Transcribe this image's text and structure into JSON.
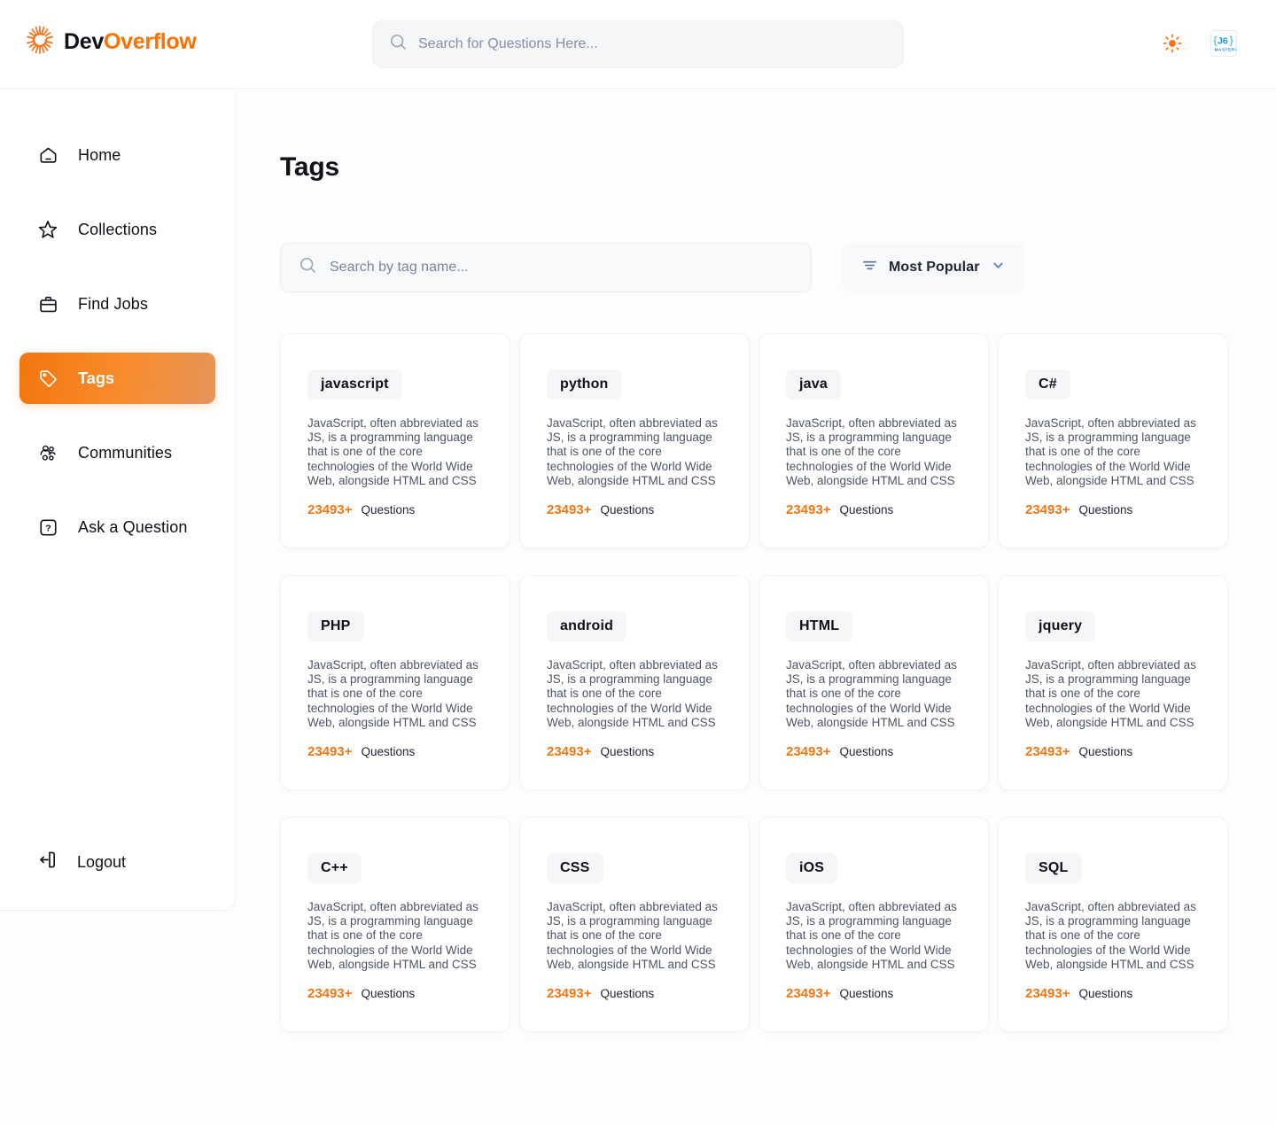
{
  "navbar": {
    "brand_prefix": "Dev",
    "brand_suffix": "Overflow",
    "logo_icon": "sun-burst-icon",
    "search": {
      "placeholder": "Search for Questions Here...",
      "value": "",
      "icon": "search-icon"
    },
    "theme_toggle_icon": "sun-icon",
    "avatar_label": "JS MASTERY",
    "accent_color": "#FF7000"
  },
  "sidebar": {
    "items": [
      {
        "label": "Home",
        "icon": "home-icon",
        "active": false
      },
      {
        "label": "Collections",
        "icon": "star-icon",
        "active": false
      },
      {
        "label": "Find Jobs",
        "icon": "suitcase-icon",
        "active": false
      },
      {
        "label": "Tags",
        "icon": "tag-icon",
        "active": true
      },
      {
        "label": "Communities",
        "icon": "users-icon",
        "active": false
      },
      {
        "label": "Ask a Question",
        "icon": "question-mark-icon",
        "active": false
      }
    ],
    "logout": {
      "label": "Logout",
      "icon": "logout-icon"
    },
    "active_gradient_from": "#F2760E",
    "active_gradient_to": "#E5955B"
  },
  "main": {
    "page_title": "Tags",
    "search": {
      "placeholder": "Search by tag name...",
      "value": "",
      "icon": "search-icon"
    },
    "sort": {
      "label": "Most Popular",
      "icon": "filter-lines-icon",
      "chevron": "chevron-down-icon"
    },
    "questions_word": "Questions",
    "tags": [
      {
        "name": "javascript",
        "description": "JavaScript, often abbreviated as JS, is a programming language that is one of the core technologies of the World Wide Web, alongside HTML and CSS",
        "count": "23493+"
      },
      {
        "name": "python",
        "description": "JavaScript, often abbreviated as JS, is a programming language that is one of the core technologies of the World Wide Web, alongside HTML and CSS",
        "count": "23493+"
      },
      {
        "name": "java",
        "description": "JavaScript, often abbreviated as JS, is a programming language that is one of the core technologies of the World Wide Web, alongside HTML and CSS",
        "count": "23493+"
      },
      {
        "name": "C#",
        "description": "JavaScript, often abbreviated as JS, is a programming language that is one of the core technologies of the World Wide Web, alongside HTML and CSS",
        "count": "23493+"
      },
      {
        "name": "PHP",
        "description": "JavaScript, often abbreviated as JS, is a programming language that is one of the core technologies of the World Wide Web, alongside HTML and CSS",
        "count": "23493+"
      },
      {
        "name": "android",
        "description": "JavaScript, often abbreviated as JS, is a programming language that is one of the core technologies of the World Wide Web, alongside HTML and CSS",
        "count": "23493+"
      },
      {
        "name": "HTML",
        "description": "JavaScript, often abbreviated as JS, is a programming language that is one of the core technologies of the World Wide Web, alongside HTML and CSS",
        "count": "23493+"
      },
      {
        "name": "jquery",
        "description": "JavaScript, often abbreviated as JS, is a programming language that is one of the core technologies of the World Wide Web, alongside HTML and CSS",
        "count": "23493+"
      },
      {
        "name": "C++",
        "description": "JavaScript, often abbreviated as JS, is a programming language that is one of the core technologies of the World Wide Web, alongside HTML and CSS",
        "count": "23493+"
      },
      {
        "name": "CSS",
        "description": "JavaScript, often abbreviated as JS, is a programming language that is one of the core technologies of the World Wide Web, alongside HTML and CSS",
        "count": "23493+"
      },
      {
        "name": "iOS",
        "description": "JavaScript, often abbreviated as JS, is a programming language that is one of the core technologies of the World Wide Web, alongside HTML and CSS",
        "count": "23493+"
      },
      {
        "name": "SQL",
        "description": "JavaScript, often abbreviated as JS, is a programming language that is one of the core technologies of the World Wide Web, alongside HTML and CSS",
        "count": "23493+"
      }
    ],
    "count_color": "#F27612"
  }
}
